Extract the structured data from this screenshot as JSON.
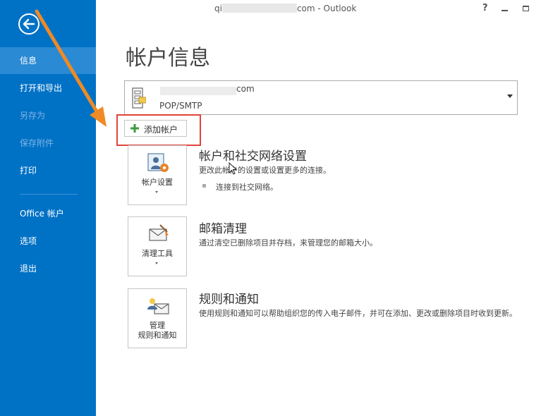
{
  "window": {
    "title_prefix": "qi",
    "title_suffix": "com - Outlook",
    "help_label": "?"
  },
  "sidebar": {
    "items": [
      {
        "label": "信息",
        "state": "active"
      },
      {
        "label": "打开和导出",
        "state": "normal"
      },
      {
        "label": "另存为",
        "state": "disabled"
      },
      {
        "label": "保存附件",
        "state": "disabled"
      },
      {
        "label": "打印",
        "state": "normal"
      },
      {
        "label": "Office 帐户",
        "state": "normal"
      },
      {
        "label": "选项",
        "state": "normal"
      },
      {
        "label": "退出",
        "state": "normal"
      }
    ]
  },
  "main": {
    "page_title": "帐户信息",
    "account": {
      "email_suffix": "com",
      "type": "POP/SMTP"
    },
    "add_account_label": "添加帐户",
    "sections": [
      {
        "tile_label": "帐户设置",
        "title": "帐户和社交网络设置",
        "description": "更改此帐户的设置或设置更多的连接。",
        "bullet": "连接到社交网络。"
      },
      {
        "tile_label": "清理工具",
        "title": "邮箱清理",
        "description": "通过清空已删除项目并存档，来管理您的邮箱大小。"
      },
      {
        "tile_label_line1": "管理",
        "tile_label_line2": "规则和通知",
        "title": "规则和通知",
        "description": "使用规则和通知可以帮助组织您的传入电子邮件，并可在添加、更改或删除项目时收到更新。"
      }
    ]
  },
  "colors": {
    "sidebar": "#0072C6",
    "sidebar_active": "#2A8AD4",
    "annotation_arrow": "#F08A24",
    "highlight_box": "#E0443A"
  }
}
